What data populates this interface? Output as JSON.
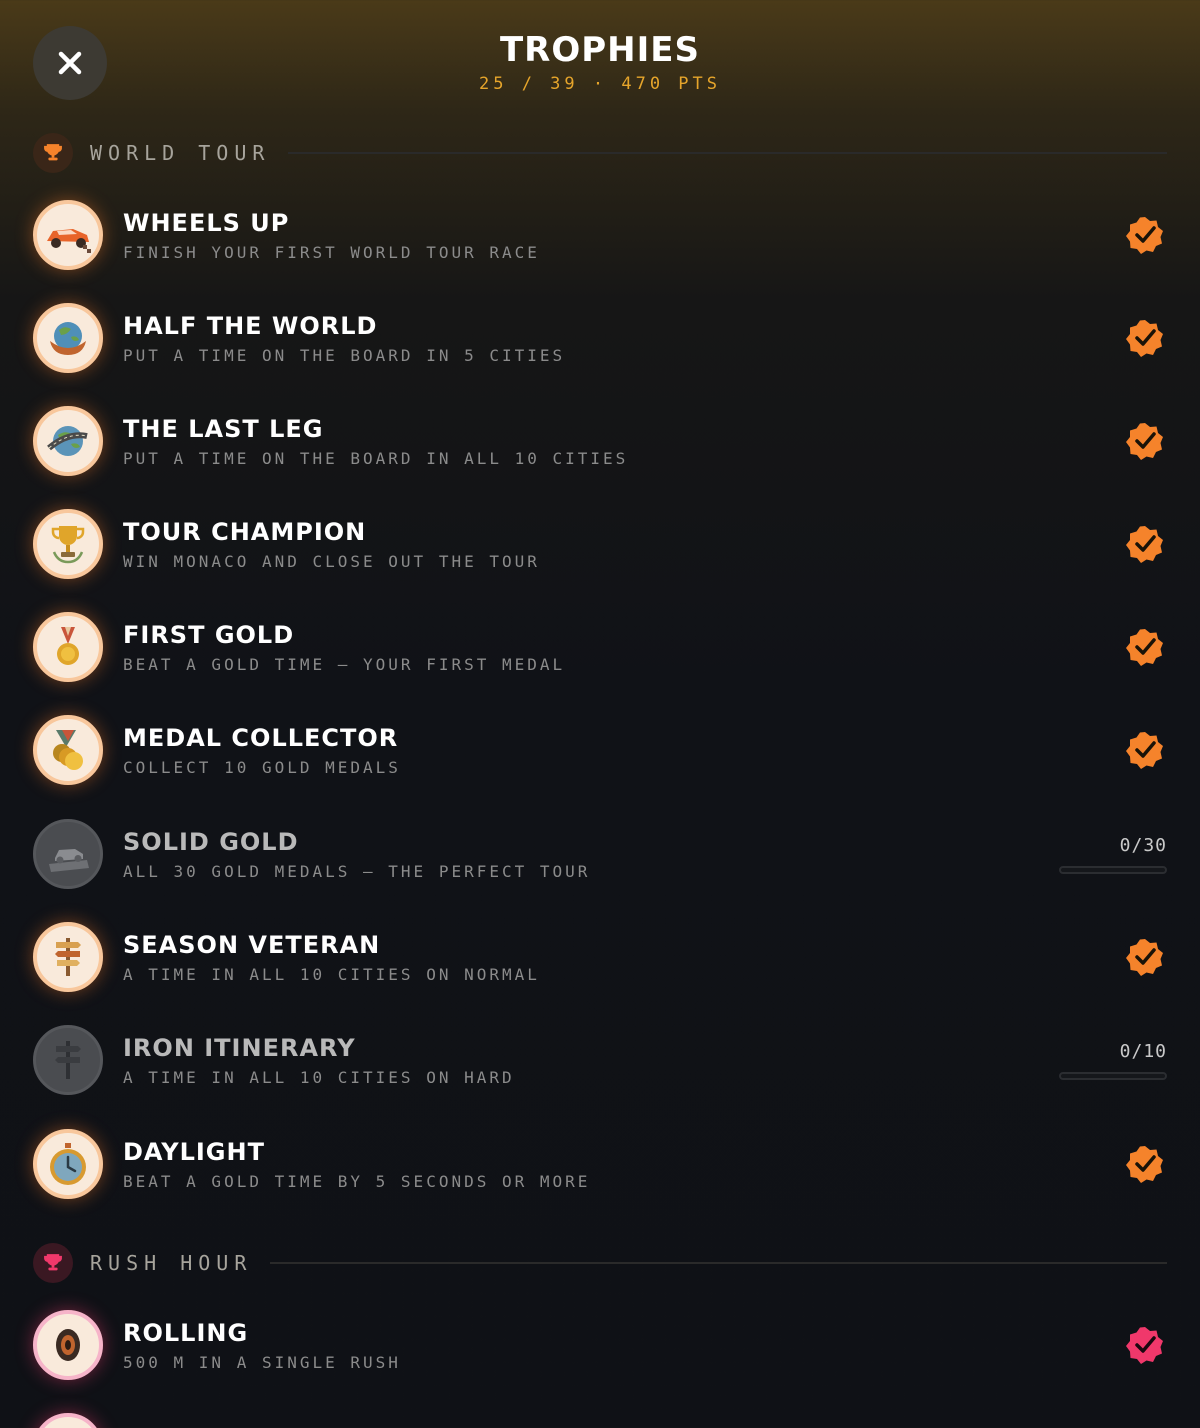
{
  "header": {
    "title": "TROPHIES",
    "subtitle": "25 / 39 · 470 PTS"
  },
  "colors": {
    "accent_orange": "#f5832b",
    "accent_pink": "#f0386b",
    "gold_text": "#e6a52b"
  },
  "sections": {
    "world_tour": {
      "label": "WORLD TOUR",
      "icon": "trophy-icon"
    },
    "rush_hour": {
      "label": "RUSH HOUR",
      "icon": "trophy-icon"
    }
  },
  "trophies": [
    {
      "name": "WHEELS UP",
      "desc": "FINISH YOUR FIRST WORLD TOUR RACE",
      "icon": "race-car-icon",
      "status": "unlocked"
    },
    {
      "name": "HALF THE WORLD",
      "desc": "PUT A TIME ON THE BOARD IN 5 CITIES",
      "icon": "half-globe-icon",
      "status": "unlocked"
    },
    {
      "name": "THE LAST LEG",
      "desc": "PUT A TIME ON THE BOARD IN ALL 10 CITIES",
      "icon": "globe-road-icon",
      "status": "unlocked"
    },
    {
      "name": "TOUR CHAMPION",
      "desc": "WIN MONACO AND CLOSE OUT THE TOUR",
      "icon": "trophy-cup-icon",
      "status": "unlocked"
    },
    {
      "name": "FIRST GOLD",
      "desc": "BEAT A GOLD TIME — YOUR FIRST MEDAL",
      "icon": "gold-medal-icon",
      "status": "unlocked"
    },
    {
      "name": "MEDAL COLLECTOR",
      "desc": "COLLECT 10 GOLD MEDALS",
      "icon": "medals-stack-icon",
      "status": "unlocked"
    },
    {
      "name": "SOLID GOLD",
      "desc": "ALL 30 GOLD MEDALS — THE PERFECT TOUR",
      "icon": "car-on-podium-icon",
      "status": "locked",
      "progress_text": "0/30",
      "progress": 0
    },
    {
      "name": "SEASON VETERAN",
      "desc": "A TIME IN ALL 10 CITIES ON NORMAL",
      "icon": "signpost-icon",
      "status": "unlocked"
    },
    {
      "name": "IRON ITINERARY",
      "desc": "A TIME IN ALL 10 CITIES ON HARD",
      "icon": "signpost-icon",
      "status": "locked",
      "progress_text": "0/10",
      "progress": 0
    },
    {
      "name": "DAYLIGHT",
      "desc": "BEAT A GOLD TIME BY 5 SECONDS OR MORE",
      "icon": "stopwatch-icon",
      "status": "unlocked"
    },
    {
      "name": "ROLLING",
      "desc": "500 M IN A SINGLE RUSH",
      "icon": "tire-icon",
      "status": "unlocked"
    }
  ]
}
